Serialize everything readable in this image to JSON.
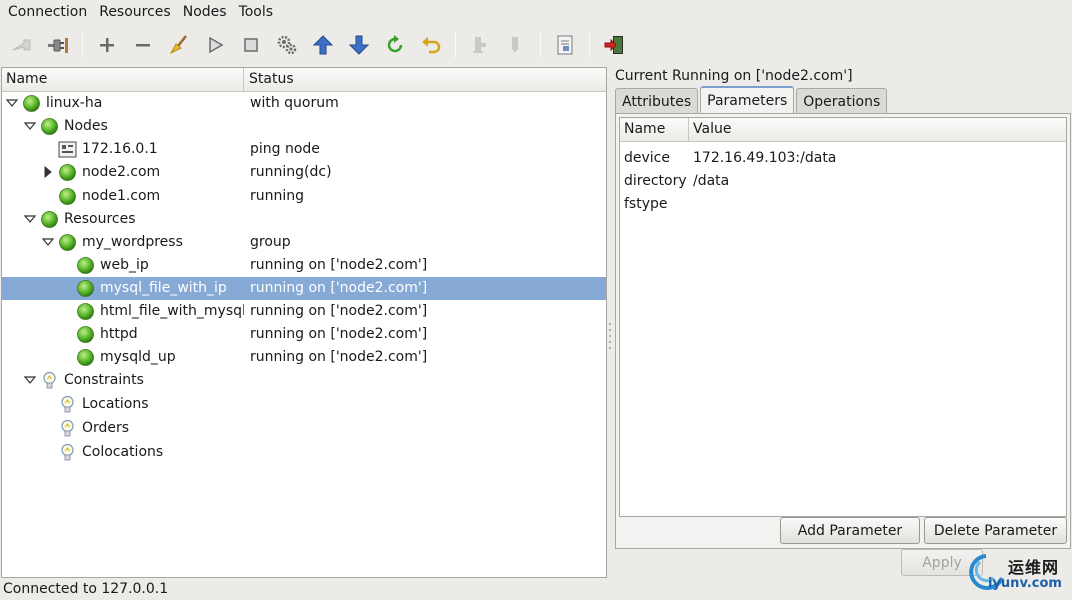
{
  "menubar": {
    "items": [
      "Connection",
      "Resources",
      "Nodes",
      "Tools"
    ]
  },
  "toolbar": {
    "buttons": [
      {
        "name": "connect-icon",
        "enabled": false
      },
      {
        "name": "disconnect-icon",
        "enabled": true
      },
      {
        "name": "add-icon",
        "enabled": true
      },
      {
        "name": "remove-icon",
        "enabled": true
      },
      {
        "name": "cleanup-broom-icon",
        "enabled": true
      },
      {
        "name": "start-icon",
        "enabled": true
      },
      {
        "name": "stop-icon",
        "enabled": true
      },
      {
        "name": "default-gears-icon",
        "enabled": true
      },
      {
        "name": "move-up-icon",
        "enabled": true
      },
      {
        "name": "move-down-icon",
        "enabled": true
      },
      {
        "name": "refresh-icon",
        "enabled": true
      },
      {
        "name": "undo-icon",
        "enabled": true
      },
      {
        "name": "standby-icon",
        "enabled": false
      },
      {
        "name": "active-icon",
        "enabled": false
      },
      {
        "name": "view-document-icon",
        "enabled": true
      },
      {
        "name": "exit-icon",
        "enabled": true
      }
    ]
  },
  "tree": {
    "columns": {
      "name": "Name",
      "status": "Status"
    },
    "rows": [
      {
        "label": "linux-ha",
        "status": "with quorum",
        "icon": "green",
        "level": 0,
        "expander": "open"
      },
      {
        "label": "Nodes",
        "status": "",
        "icon": "green",
        "level": 1,
        "expander": "open"
      },
      {
        "label": "172.16.0.1",
        "status": "ping node",
        "icon": "ping",
        "level": 2,
        "expander": "none"
      },
      {
        "label": "node2.com",
        "status": "running(dc)",
        "icon": "green",
        "level": 2,
        "expander": "closed"
      },
      {
        "label": "node1.com",
        "status": "running",
        "icon": "green",
        "level": 2,
        "expander": "none"
      },
      {
        "label": "Resources",
        "status": "",
        "icon": "green",
        "level": 1,
        "expander": "open"
      },
      {
        "label": "my_wordpress",
        "status": "group",
        "icon": "green",
        "level": 2,
        "expander": "open"
      },
      {
        "label": "web_ip",
        "status": "running on ['node2.com']",
        "icon": "green",
        "level": 3,
        "expander": "none"
      },
      {
        "label": "mysql_file_with_ip",
        "status": "running on ['node2.com']",
        "icon": "green",
        "level": 3,
        "expander": "none",
        "selected": true
      },
      {
        "label": "html_file_with_mysql",
        "status": "running on ['node2.com']",
        "icon": "green",
        "level": 3,
        "expander": "none"
      },
      {
        "label": "httpd",
        "status": "running on ['node2.com']",
        "icon": "green",
        "level": 3,
        "expander": "none"
      },
      {
        "label": "mysqld_up",
        "status": "running on ['node2.com']",
        "icon": "green",
        "level": 3,
        "expander": "none"
      },
      {
        "label": "Constraints",
        "status": "",
        "icon": "bulb",
        "level": 1,
        "expander": "open"
      },
      {
        "label": "Locations",
        "status": "",
        "icon": "bulb",
        "level": 2,
        "expander": "none"
      },
      {
        "label": "Orders",
        "status": "",
        "icon": "bulb",
        "level": 2,
        "expander": "none"
      },
      {
        "label": "Colocations",
        "status": "",
        "icon": "bulb",
        "level": 2,
        "expander": "none"
      }
    ]
  },
  "detail": {
    "title": "Current Running on ['node2.com']",
    "tabs": [
      "Attributes",
      "Parameters",
      "Operations"
    ],
    "active_tab": "Parameters",
    "columns": {
      "name": "Name",
      "value": "Value"
    },
    "params": [
      {
        "name": "device",
        "value": "172.16.49.103:/data"
      },
      {
        "name": "directory",
        "value": "/data"
      },
      {
        "name": "fstype",
        "value": ""
      }
    ],
    "add_button": "Add Parameter",
    "delete_button": "Delete Parameter",
    "apply_button": "Apply"
  },
  "statusbar": {
    "text": "Connected to 127.0.0.1"
  },
  "watermark": {
    "cn": "运维网",
    "url": "iyunv.com"
  },
  "colors": {
    "selection": "#86a9d6",
    "status_green": "#5cb82e",
    "tab_accent": "#7ba0d0"
  }
}
